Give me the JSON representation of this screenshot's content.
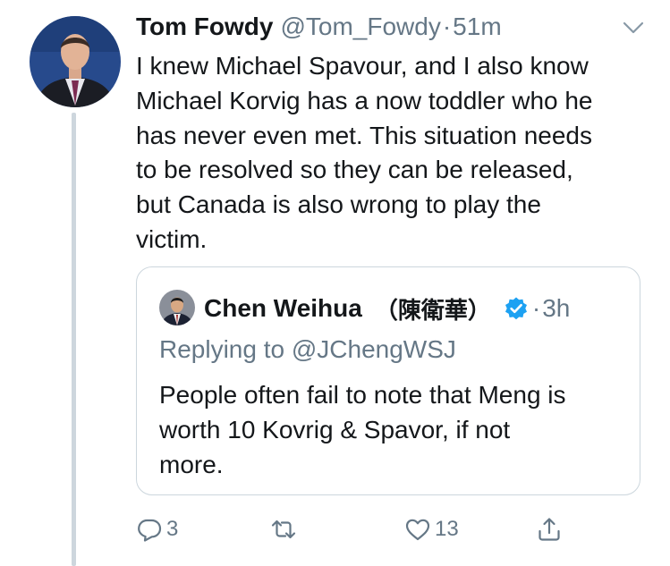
{
  "tweet": {
    "author_name": "Tom Fowdy",
    "handle": "@Tom_Fowdy",
    "separator": "·",
    "time": "51m",
    "lines": [
      "I knew Michael Spavour, and I also know",
      "Michael Korvig has a now toddler who he",
      "has never even met. This situation needs",
      "to be resolved so they can be released,",
      "but Canada is also wrong to play the",
      "victim."
    ]
  },
  "quoted_tweet": {
    "author_name": "Chen Weihua",
    "author_name_cjk": "（陳衛華）",
    "separator": "·",
    "time": "3h",
    "replying_to": "Replying to @JChengWSJ",
    "lines": [
      "People often fail to note that Meng is",
      "worth 10 Kovrig & Spavor, if not",
      "more."
    ]
  },
  "actions": {
    "reply_count": "3",
    "retweet_count": "",
    "like_count": "13"
  },
  "colors": {
    "text": "#14171a",
    "secondary": "#657786",
    "verified": "#1da1f2",
    "thread_line": "#cdd6dd",
    "quote_border": "#ccd6dd"
  },
  "icons": [
    "reply-icon",
    "retweet-icon",
    "like-icon",
    "share-icon",
    "chevron-down-icon",
    "verified-badge-icon"
  ]
}
